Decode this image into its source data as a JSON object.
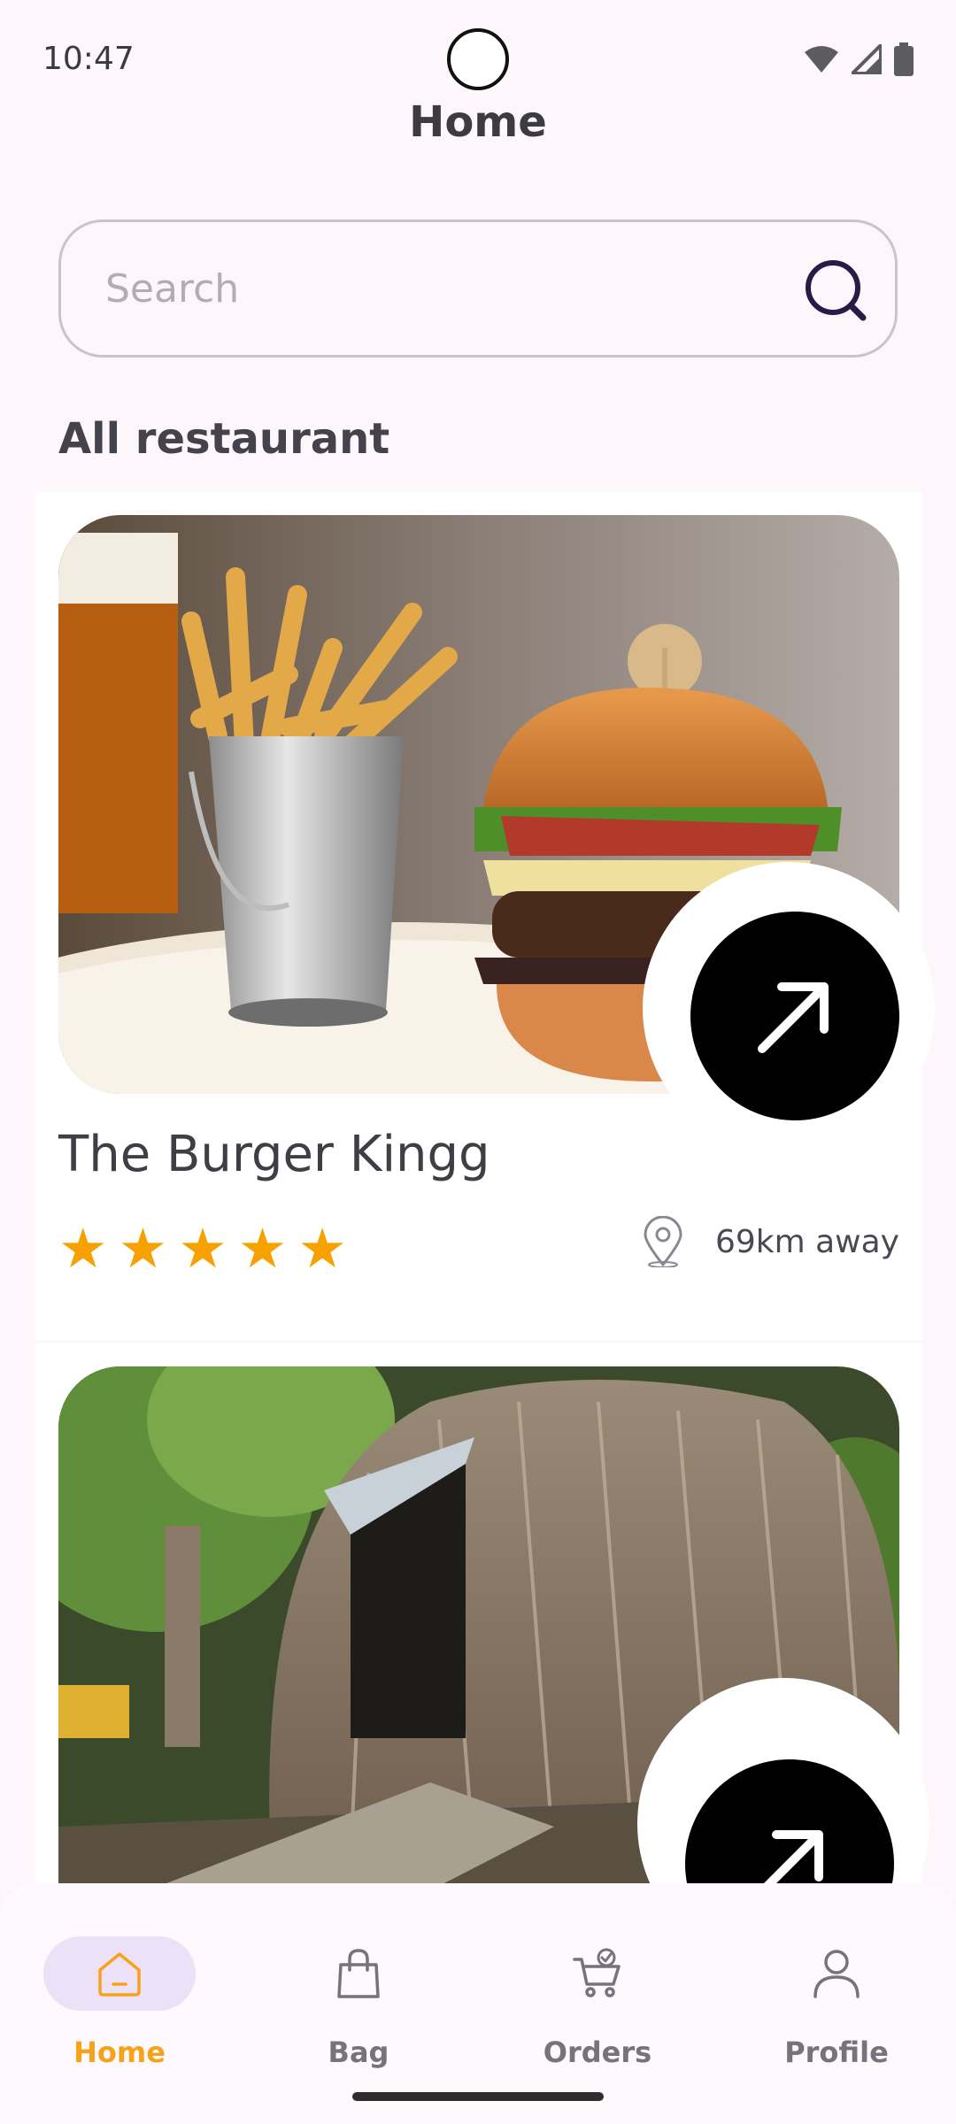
{
  "status_bar": {
    "time": "10:47"
  },
  "header": {
    "title": "Home"
  },
  "search": {
    "placeholder": "Search"
  },
  "section": {
    "title": "All restaurant"
  },
  "restaurants": [
    {
      "name": "The Burger Kingg",
      "rating": 5,
      "rating_stars": "★★★★★",
      "distance": "69km away"
    },
    {
      "name": "",
      "rating": null,
      "distance": ""
    }
  ],
  "bottom_nav": [
    {
      "label": "Home",
      "icon": "home-icon",
      "active": true
    },
    {
      "label": "Bag",
      "icon": "bag-icon",
      "active": false
    },
    {
      "label": "Orders",
      "icon": "orders-cart-icon",
      "active": false
    },
    {
      "label": "Profile",
      "icon": "profile-icon",
      "active": false
    }
  ],
  "colors": {
    "background": "#fdf7fc",
    "accent": "#f6a21a",
    "star": "#f7a100",
    "nav_active_pill": "#ece1f7",
    "button": "#000000"
  }
}
